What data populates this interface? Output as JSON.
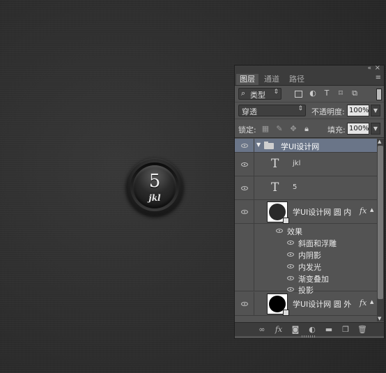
{
  "canvas": {
    "button_number": "5",
    "button_subtitle": "jkl"
  },
  "panel": {
    "collapse_icon": "«",
    "close_icon": "×",
    "menu_icon": "≡",
    "tabs": [
      {
        "label": "图层",
        "active": true
      },
      {
        "label": "通道",
        "active": false
      },
      {
        "label": "路径",
        "active": false
      }
    ],
    "filter": {
      "kind_label": "类型",
      "icons": [
        "image-filter-icon",
        "adjustment-filter-icon",
        "text-filter-icon",
        "shape-filter-icon",
        "smart-object-filter-icon"
      ]
    },
    "blend_mode": "穿透",
    "opacity_label": "不透明度:",
    "opacity_value": "100%",
    "lock_label": "锁定:",
    "fill_label": "填充:",
    "fill_value": "100%",
    "layers": {
      "group_name": "学UI设计网",
      "text_layer_1": "jkl",
      "text_layer_2": "5",
      "shape_layer_1": "学UI设计网 圆 内",
      "effects_label": "效果",
      "effects": [
        "斜面和浮雕",
        "内阴影",
        "内发光",
        "渐变叠加",
        "投影"
      ],
      "shape_layer_2": "学UI设计网 圆 外",
      "fx_label": "fx"
    },
    "bottom_icons": [
      "link-layers-icon",
      "add-style-icon",
      "add-mask-icon",
      "new-adjustment-icon",
      "new-group-icon",
      "new-layer-icon",
      "delete-layer-icon"
    ]
  }
}
